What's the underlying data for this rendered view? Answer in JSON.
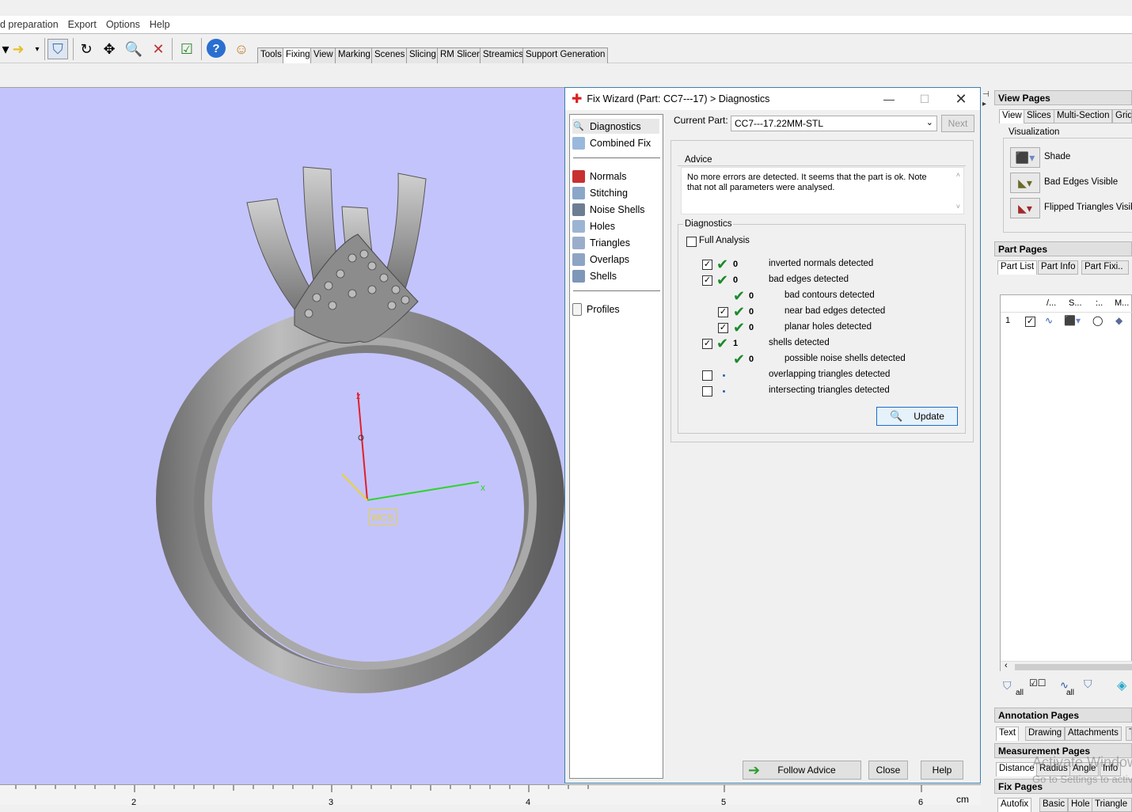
{
  "menu": [
    "d preparation",
    "Export",
    "Options",
    "Help"
  ],
  "ribbon_tabs": [
    {
      "label": "Tools"
    },
    {
      "label": "Fixing"
    },
    {
      "label": "View"
    },
    {
      "label": "Marking"
    },
    {
      "label": "Scenes"
    },
    {
      "label": "Slicing"
    },
    {
      "label": "RM Slicer"
    },
    {
      "label": "Streamics"
    },
    {
      "label": "Support Generation"
    }
  ],
  "viewport": {
    "wcs_label": "WCS",
    "axis_z": "z",
    "axis_x": "x",
    "colors": {
      "background": "#c4c4fc",
      "z_axis": "#e0202a",
      "x_axis": "#2fd42f",
      "y_axis": "#e8d23a"
    }
  },
  "ruler": {
    "ticks": [
      "2",
      "3",
      "4",
      "5",
      "6"
    ],
    "unit": "cm"
  },
  "dialog": {
    "title": "Fix Wizard (Part: CC7---17) > Diagnostics",
    "nav": {
      "diagnostics": "Diagnostics",
      "combined_fix": "Combined Fix",
      "normals": "Normals",
      "stitching": "Stitching",
      "noise_shells": "Noise Shells",
      "holes": "Holes",
      "triangles": "Triangles",
      "overlaps": "Overlaps",
      "shells": "Shells",
      "profiles": "Profiles"
    },
    "current_part_label": "Current Part:",
    "current_part_value": "CC7---17.22MM-STL",
    "next_button": "Next",
    "advice_label": "Advice",
    "advice_text": "No more errors are detected. It seems that the part is ok. Note that not all parameters were analysed.",
    "diagnostics_label": "Diagnostics",
    "full_analysis": "Full Analysis",
    "rows": {
      "inverted_normals": {
        "count": "0",
        "label": "inverted normals detected"
      },
      "bad_edges": {
        "count": "0",
        "label": "bad edges detected"
      },
      "bad_contours": {
        "count": "0",
        "label": "bad contours detected"
      },
      "near_bad_edges": {
        "count": "0",
        "label": "near bad edges detected"
      },
      "planar_holes": {
        "count": "0",
        "label": "planar holes detected"
      },
      "shells": {
        "count": "1",
        "label": "shells detected"
      },
      "noise_shells": {
        "count": "0",
        "label": "possible noise shells detected"
      },
      "overlapping": {
        "label": "overlapping triangles detected"
      },
      "intersecting": {
        "label": "intersecting triangles detected"
      }
    },
    "update_button": "Update",
    "follow_advice_button": "Follow Advice",
    "close_button": "Close",
    "help_button": "Help"
  },
  "view_pages": {
    "title": "View Pages",
    "tabs": [
      "View",
      "Slices",
      "Multi-Section",
      "Grid"
    ],
    "visualization_label": "Visualization",
    "shade": "Shade",
    "bad_edges_visible": "Bad Edges Visible",
    "flipped_triangles_visible": "Flipped Triangles Visible"
  },
  "part_pages": {
    "title": "Part Pages",
    "tabs": [
      "Part List",
      "Part Info",
      "Part Fixi.."
    ],
    "columns": [
      "/...",
      "S...",
      ":..",
      "M..."
    ],
    "row_index": "1",
    "footer_all_1": "all",
    "footer_all_2": "all"
  },
  "annotation_pages": {
    "title": "Annotation Pages",
    "tabs": [
      "Text",
      "Drawing",
      "Attachments",
      "T"
    ]
  },
  "measurement_pages": {
    "title": "Measurement Pages",
    "tabs": [
      "Distance",
      "Radius",
      "Angle",
      "Info"
    ]
  },
  "fix_pages": {
    "title": "Fix Pages",
    "tabs": [
      "Autofix",
      "Basic",
      "Hole",
      "Triangle"
    ]
  },
  "watermark": {
    "line1": "Activate Windows",
    "line2": "Go to Settings to activate"
  }
}
